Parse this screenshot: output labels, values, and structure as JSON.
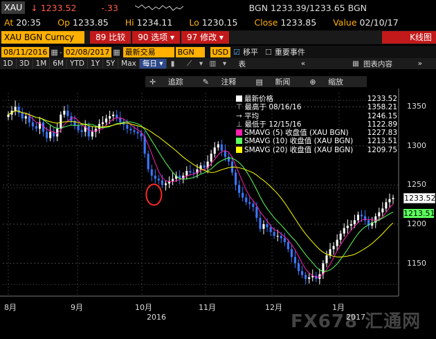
{
  "header": {
    "symbol": "XAU",
    "last_arrow": "↓",
    "last": "1233.52",
    "change": "-.33",
    "bid_ask": "BGN 1233.39/1233.65 BGN",
    "at_label": "At",
    "at": "20:35",
    "op_label": "Op",
    "op": "1233.85",
    "hi_label": "Hi",
    "hi": "1234.11",
    "lo_label": "Lo",
    "lo": "1230.15",
    "close_label": "Close",
    "close": "1233.85",
    "value_label": "Value",
    "value": "02/10/17"
  },
  "toolbar": {
    "ticker": "XAU BGN Curncy",
    "menu1": "89 比较",
    "menu2": "90 选项 ▾",
    "menu3": "97 修改 ▾",
    "kline": "K线图",
    "date_from": "08/11/2016",
    "date_to": "02/08/2017",
    "period_select": "最新交易",
    "source_select": "BGN",
    "currency_select": "USD",
    "move_label": "移平",
    "events_label": "重要事件",
    "table_label": "表",
    "chart_content": "图表内容"
  },
  "periods": [
    "1D",
    "3D",
    "1M",
    "6M",
    "YTD",
    "1Y",
    "5Y",
    "Max"
  ],
  "period_active": "每日 ▾",
  "tools": [
    "追踪",
    "注释",
    "新闻",
    "缩放"
  ],
  "legend": [
    {
      "label": "最新价格",
      "value": "1233.52",
      "color": "#ffffff"
    },
    {
      "label": "最高于 08/16/16",
      "value": "1358.21",
      "color": ""
    },
    {
      "label": "平均",
      "value": "1246.15",
      "color": ""
    },
    {
      "label": "最低于 12/15/16",
      "value": "1122.89",
      "color": ""
    },
    {
      "label": "SMAVG (5) 收盘值 (XAU BGN)",
      "value": "1227.83",
      "color": "#ff1fb0"
    },
    {
      "label": "SMAVG (10) 收盘值 (XAU BGN)",
      "value": "1213.51",
      "color": "#5cff5c"
    },
    {
      "label": "SMAVG (20) 收盘值 (XAU BGN)",
      "value": "1209.75",
      "color": "#ffff00"
    }
  ],
  "y_ticks": [
    "1350",
    "1300",
    "1250",
    "1200",
    "1150"
  ],
  "x_ticks": [
    "8月",
    "9月",
    "10月",
    "11月",
    "12月",
    "1月"
  ],
  "year_labels": [
    "2016",
    "2017"
  ],
  "price_tags": {
    "last": "1233.52",
    "sma10": "1213.51"
  },
  "watermark": "FX678 汇通网",
  "chart_data": {
    "type": "candlestick",
    "ylim": [
      1108,
      1368
    ],
    "closes": [
      1340,
      1345,
      1350,
      1342,
      1335,
      1338,
      1330,
      1325,
      1322,
      1330,
      1318,
      1310,
      1318,
      1312,
      1322,
      1340,
      1345,
      1338,
      1332,
      1326,
      1320,
      1318,
      1325,
      1312,
      1318,
      1322,
      1328,
      1330,
      1335,
      1338,
      1340,
      1336,
      1330,
      1327,
      1322,
      1320,
      1318,
      1316,
      1312,
      1290,
      1270,
      1262,
      1258,
      1256,
      1250,
      1252,
      1255,
      1258,
      1262,
      1258,
      1262,
      1268,
      1266,
      1265,
      1270,
      1275,
      1272,
      1280,
      1290,
      1298,
      1302,
      1294,
      1286,
      1280,
      1266,
      1250,
      1240,
      1234,
      1228,
      1226,
      1222,
      1208,
      1194,
      1200,
      1196,
      1190,
      1185,
      1185,
      1182,
      1177,
      1168,
      1158,
      1150,
      1140,
      1135,
      1130,
      1132,
      1134,
      1130,
      1136,
      1150,
      1160,
      1168,
      1172,
      1180,
      1188,
      1195,
      1198,
      1200,
      1205,
      1212,
      1210,
      1205,
      1198,
      1202,
      1210,
      1215,
      1220,
      1228,
      1232,
      1233.52
    ],
    "sma": [
      {
        "name": "SMAVG (5) 收盘值 (XAU BGN)",
        "color": "#ff1fb0",
        "period": 5
      },
      {
        "name": "SMAVG (10) 收盘值 (XAU BGN)",
        "color": "#5cff5c",
        "period": 10
      },
      {
        "name": "SMAVG (20) 收盘值 (XAU BGN)",
        "color": "#ffff00",
        "period": 20
      }
    ],
    "ref_lines": [
      1358.21,
      1246.15,
      1122.89
    ],
    "ref_line_color": "#888888",
    "up_color": "#ffffff",
    "down_color": "#3a78ff",
    "annotation_color": "#ff2a2a"
  }
}
